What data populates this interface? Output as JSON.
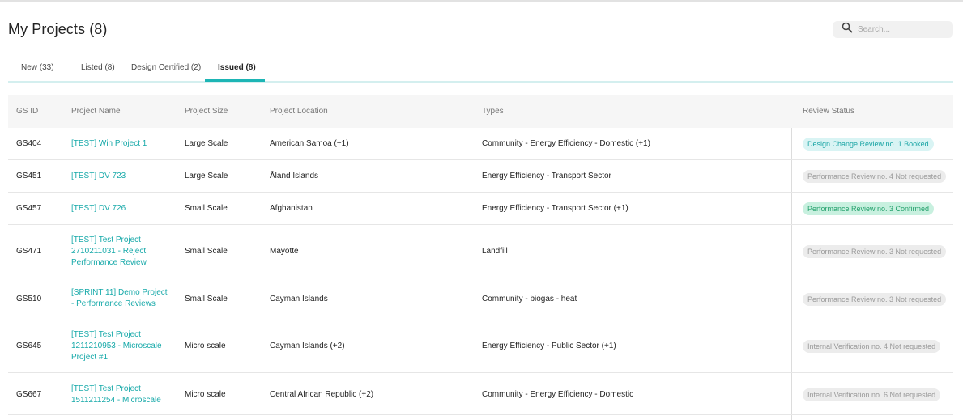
{
  "header": {
    "title": "My Projects (8)",
    "search_placeholder": "Search..."
  },
  "tabs": [
    {
      "label": "New (33)",
      "active": false
    },
    {
      "label": "Listed (8)",
      "active": false
    },
    {
      "label": "Design Certified (2)",
      "active": false
    },
    {
      "label": "Issued (8)",
      "active": true
    }
  ],
  "table": {
    "columns": [
      "GS ID",
      "Project Name",
      "Project Size",
      "Project Location",
      "Types",
      "Review Status"
    ],
    "rows": [
      {
        "id": "GS404",
        "name": "[TEST] Win Project 1",
        "size": "Large Scale",
        "location": "American Samoa (+1)",
        "types": "Community - Energy Efficiency - Domestic (+1)",
        "status": "Design Change Review no. 1 Booked",
        "status_kind": "booked"
      },
      {
        "id": "GS451",
        "name": "[TEST] DV 723",
        "size": "Large Scale",
        "location": "Åland Islands",
        "types": "Energy Efficiency - Transport Sector",
        "status": "Performance Review no. 4 Not requested",
        "status_kind": "notreq"
      },
      {
        "id": "GS457",
        "name": "[TEST] DV 726",
        "size": "Small Scale",
        "location": "Afghanistan",
        "types": "Energy Efficiency - Transport Sector (+1)",
        "status": "Performance Review no. 3 Confirmed",
        "status_kind": "confirmed"
      },
      {
        "id": "GS471",
        "name": "[TEST] Test Project 2710211031 - Reject Performance Review",
        "name_lines": [
          "[TEST] Test Project",
          "2710211031 - Reject",
          "Performance Review"
        ],
        "size": "Small Scale",
        "location": "Mayotte",
        "types": "Landfill",
        "status": "Performance Review no. 3 Not requested",
        "status_kind": "notreq"
      },
      {
        "id": "GS510",
        "name": "[SPRINT 11] Demo Project - Performance Reviews",
        "name_lines": [
          "[SPRINT 11] Demo Project",
          "- Performance Reviews"
        ],
        "size": "Small Scale",
        "location": "Cayman Islands",
        "types": "Community - biogas - heat",
        "status": "Performance Review no. 3 Not requested",
        "status_kind": "notreq"
      },
      {
        "id": "GS645",
        "name": "[TEST] Test Project 1211210953 - Microscale Project #1",
        "name_lines": [
          "[TEST] Test Project",
          "1211210953 - Microscale",
          "Project #1"
        ],
        "size": "Micro scale",
        "location": "Cayman Islands (+2)",
        "types": "Energy Efficiency - Public Sector (+1)",
        "status": "Internal Verification no. 4 Not requested",
        "status_kind": "notreq"
      },
      {
        "id": "GS667",
        "name": "[TEST] Test Project 1511211254 - Microscale",
        "name_lines": [
          "[TEST] Test Project",
          "1511211254 - Microscale"
        ],
        "size": "Micro scale",
        "location": "Central African Republic (+2)",
        "types": "Community - Energy Efficiency - Domestic",
        "status": "Internal Verification no. 6 Not requested",
        "status_kind": "notreq"
      }
    ]
  },
  "colors": {
    "accent": "#1db5b5",
    "link": "#17a9a9",
    "confirmed_bg": "#c8f0df",
    "booked_bg": "#d9f4f4",
    "notrequested_bg": "#ececec"
  },
  "icons": {
    "search": "search-icon"
  }
}
